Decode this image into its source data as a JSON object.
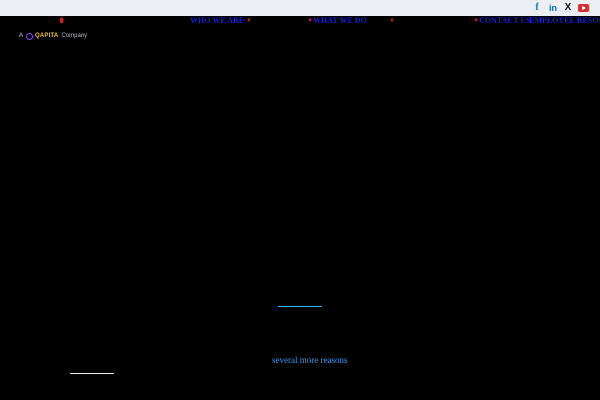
{
  "social": {
    "facebook": "f",
    "linkedin": "in",
    "x": "X",
    "icons": [
      "facebook-icon",
      "linkedin-icon",
      "x-icon",
      "youtube-icon"
    ]
  },
  "nav": {
    "items": [
      {
        "label": "WHO WE ARE",
        "has_dropdown": true
      },
      {
        "label": "WHAT WE DO",
        "has_dropdown": true
      },
      {
        "label": "CONTACT US",
        "has_dropdown": false
      }
    ],
    "secondary_label": "EMPLOYEE RESOURCES"
  },
  "logo": {
    "prefix": "A",
    "brand": "QAPITA",
    "suffix": "Company"
  },
  "content": {
    "link_text": "several more reasons"
  },
  "colors": {
    "nav_text": "#1a1ae0",
    "chevron": "#c62828",
    "link": "#3d9be9",
    "underline_accent": "#29b6f6",
    "social_bar_bg": "#eceff1"
  }
}
